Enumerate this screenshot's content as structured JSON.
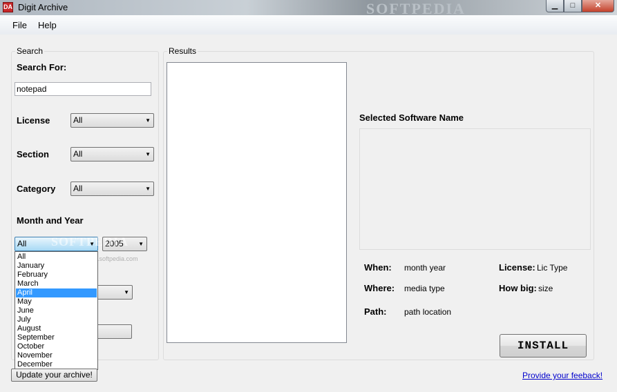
{
  "window": {
    "title": "Digit Archive",
    "icon_text": "DA",
    "watermark": "SOFTPEDIA",
    "controls": {
      "minimize": "▁",
      "maximize": "□",
      "close": "✕"
    }
  },
  "menu": {
    "file": "File",
    "help": "Help"
  },
  "search": {
    "legend": "Search",
    "search_for_label": "Search For:",
    "search_value": "notepad",
    "license_label": "License",
    "license_value": "All",
    "section_label": "Section",
    "section_value": "All",
    "category_label": "Category",
    "category_value": "All",
    "month_year_label": "Month and Year",
    "month_value": "All",
    "year_value": "2005",
    "month_options": [
      "All",
      "January",
      "February",
      "March",
      "April",
      "May",
      "June",
      "July",
      "August",
      "September",
      "October",
      "November",
      "December"
    ],
    "month_highlighted": "April",
    "update_button": "Update your archive!"
  },
  "results": {
    "legend": "Results",
    "selected_name_label": "Selected Software Name",
    "when_label": "When:",
    "when_value": "month  year",
    "where_label": "Where:",
    "where_value": "media type",
    "path_label": "Path:",
    "path_value": "path location",
    "license_label": "License:",
    "license_value": "Lic Type",
    "howbig_label": "How big:",
    "howbig_value": "size",
    "install_button": "INSTALL",
    "feedback_link": "Provide your feeback!"
  },
  "watermark_url": "www.softpedia.com",
  "arrow_glyph": "▼"
}
